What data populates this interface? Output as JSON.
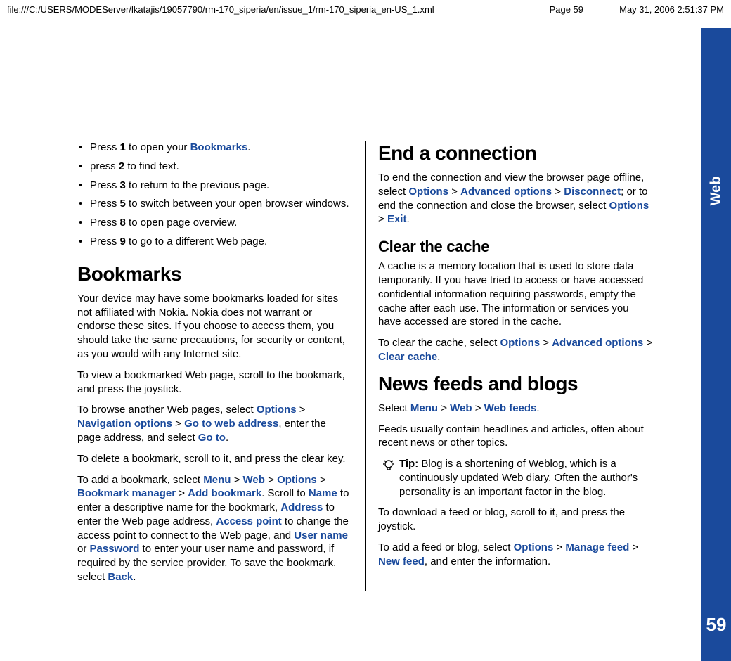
{
  "header": {
    "path": "file:///C:/USERS/MODEServer/lkatajis/19057790/rm-170_siperia/en/issue_1/rm-170_siperia_en-US_1.xml",
    "page": "Page 59",
    "time": "May 31, 2006 2:51:37 PM"
  },
  "side": {
    "tab": "Web",
    "pagenum": "59"
  },
  "left": {
    "bullets": {
      "b1a": "Press ",
      "b1b": "1",
      "b1c": " to open your ",
      "b1d": "Bookmarks",
      "b1e": ".",
      "b2a": "press ",
      "b2b": "2",
      "b2c": " to find text.",
      "b3a": "Press ",
      "b3b": "3",
      "b3c": " to return to the previous page.",
      "b4a": "Press ",
      "b4b": "5",
      "b4c": " to switch between your open browser windows.",
      "b5a": "Press ",
      "b5b": "8",
      "b5c": " to open page overview.",
      "b6a": "Press ",
      "b6b": "9",
      "b6c": " to go to a different Web page."
    },
    "h_bookmarks": "Bookmarks",
    "p1": "Your device may have some bookmarks loaded for sites not affiliated with Nokia. Nokia does not warrant or endorse these sites. If you choose to access them, you should take the same precautions, for security or content, as you would with any Internet site.",
    "p2": "To view a bookmarked Web page, scroll to the bookmark, and press the joystick.",
    "p3a": "To browse another Web pages, select ",
    "p3b": "Options",
    "p3c": " > ",
    "p3d": "Navigation options",
    "p3e": " > ",
    "p3f": "Go to web address",
    "p3g": ", enter the page address, and select ",
    "p3h": "Go to",
    "p3i": ".",
    "p4": "To delete a bookmark, scroll to it, and press the clear key.",
    "p5a": "To add a bookmark, select ",
    "p5b": "Menu",
    "p5c": " > ",
    "p5d": "Web",
    "p5e": " > ",
    "p5f": "Options",
    "p5g": " > ",
    "p5h": "Bookmark manager",
    "p5i": " > ",
    "p5j": "Add bookmark",
    "p5k": ". Scroll to ",
    "p5l": "Name",
    "p5m": " to enter a descriptive name for the bookmark, ",
    "p5n": "Address",
    "p5o": " to enter the Web page address, ",
    "p5p": "Access point",
    "p5q": " to change the access point to connect to the Web page, and ",
    "p5r": "User name",
    "p5s": " or ",
    "p5t": "Password",
    "p5u": " to enter your user name and password, if required by the service provider. To save the bookmark, select ",
    "p5v": "Back",
    "p5w": "."
  },
  "right": {
    "h_end": "End a connection",
    "p1a": "To end the connection and view the browser page offline, select ",
    "p1b": "Options",
    "p1c": " > ",
    "p1d": "Advanced options",
    "p1e": " > ",
    "p1f": "Disconnect",
    "p1g": "; or to end the connection and close the browser, select ",
    "p1h": "Options",
    "p1i": " > ",
    "p1j": "Exit",
    "p1k": ".",
    "h_cache": "Clear the cache",
    "p2": "A cache is a memory location that is used to store data temporarily. If you have tried to access or have accessed confidential information requiring passwords, empty the cache after each use. The information or services you have accessed are stored in the cache.",
    "p3a": "To clear the cache, select ",
    "p3b": "Options",
    "p3c": " > ",
    "p3d": "Advanced options",
    "p3e": " > ",
    "p3f": "Clear cache",
    "p3g": ".",
    "h_news": "News feeds and blogs",
    "p4a": "Select ",
    "p4b": "Menu",
    "p4c": " > ",
    "p4d": "Web",
    "p4e": " > ",
    "p4f": "Web feeds",
    "p4g": ".",
    "p5": "Feeds usually contain headlines and articles, often about recent news or other topics.",
    "tip_label": "Tip:",
    "tip_text": " Blog is a shortening of Weblog, which is a continuously updated Web diary. Often the author's personality is an important factor in the blog.",
    "p6": "To download a feed or blog, scroll to it, and press the joystick.",
    "p7a": "To add a feed or blog, select ",
    "p7b": "Options",
    "p7c": " > ",
    "p7d": "Manage feed",
    "p7e": " > ",
    "p7f": "New feed",
    "p7g": ", and enter the information."
  }
}
